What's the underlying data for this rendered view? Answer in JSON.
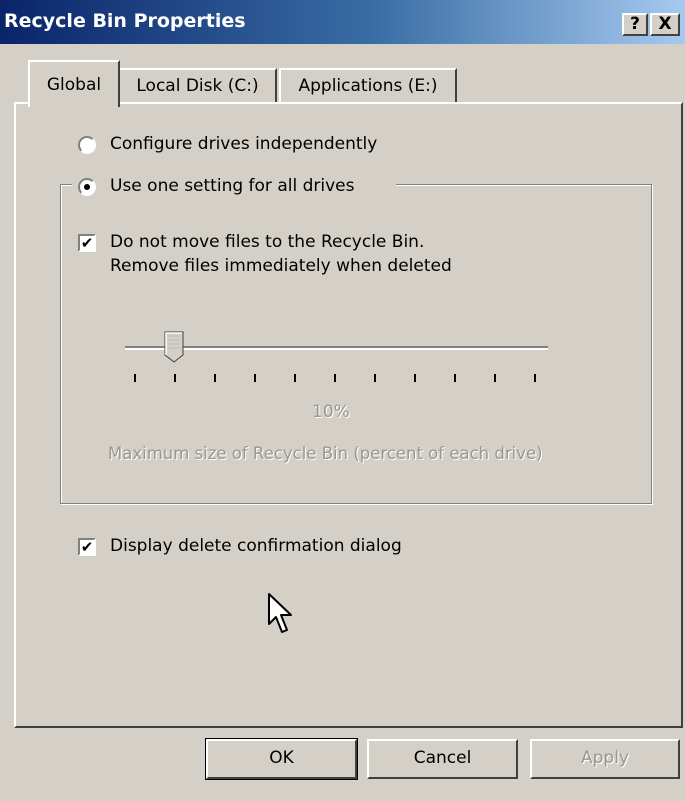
{
  "window": {
    "title": "Recycle Bin Properties",
    "help_label": "?",
    "close_label": "X"
  },
  "tabs": [
    {
      "label": "Global",
      "active": true
    },
    {
      "label": "Local Disk (C:)",
      "active": false
    },
    {
      "label": "Applications (E:)",
      "active": false
    }
  ],
  "global": {
    "radio_independent": {
      "label": "Configure drives independently",
      "selected": false
    },
    "radio_one_setting": {
      "label": "Use one setting for all drives",
      "selected": true
    },
    "no_move_checkbox": {
      "label_line1": "Do not move files to the Recycle Bin.",
      "label_line2": "Remove files immediately when deleted",
      "checked": true
    },
    "slider": {
      "value_percent": 10,
      "value_label": "10%",
      "caption": "Maximum size of Recycle Bin (percent of each drive)",
      "tick_count": 11,
      "enabled": false
    },
    "confirm_checkbox": {
      "label": "Display delete confirmation dialog",
      "checked": true
    }
  },
  "buttons": {
    "ok": "OK",
    "cancel": "Cancel",
    "apply": "Apply"
  },
  "colors": {
    "title_gradient_start": "#0a246a",
    "title_gradient_end": "#a6caf0",
    "face": "#d4d0c8",
    "disabled_text": "#9a9690"
  }
}
